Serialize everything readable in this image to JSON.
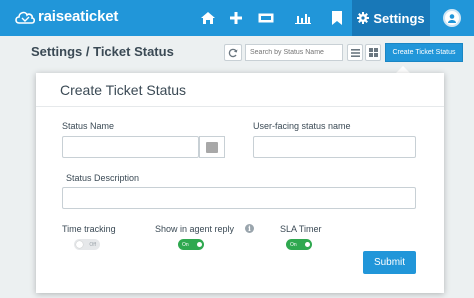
{
  "header": {
    "brand": "raiseaticket",
    "nav": [
      {
        "icon": "home-icon"
      },
      {
        "icon": "plus-icon"
      },
      {
        "icon": "ticket-icon"
      },
      {
        "icon": "bar-chart-icon"
      },
      {
        "icon": "bookmark-icon"
      }
    ],
    "settings_label": "Settings",
    "colors": {
      "bar": "#2196d9",
      "active": "#1878b8"
    }
  },
  "toolbar": {
    "page_title": "Settings / Ticket Status",
    "search_placeholder": "Search by Status Name",
    "create_label": "Create Ticket Status"
  },
  "form": {
    "title": "Create Ticket Status",
    "status_name_label": "Status Name",
    "status_name_value": "",
    "user_facing_label": "User-facing status name",
    "user_facing_value": "",
    "description_label": "Status Description",
    "description_value": "",
    "time_tracking_label": "Time tracking",
    "time_tracking_state": "Off",
    "agent_reply_label": "Show in agent reply",
    "agent_reply_state": "On",
    "sla_timer_label": "SLA Timer",
    "sla_timer_state": "On",
    "submit_label": "Submit",
    "color_swatch": "#a8a8a8"
  }
}
